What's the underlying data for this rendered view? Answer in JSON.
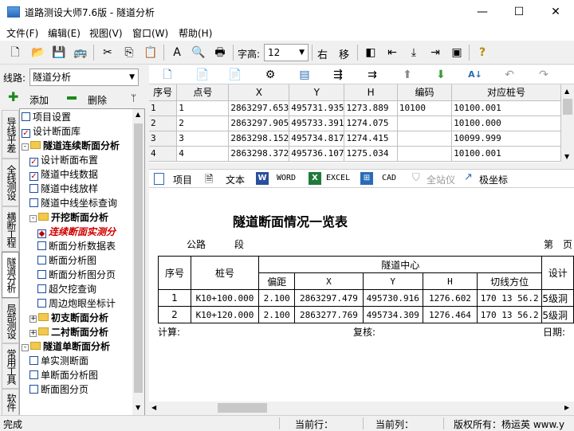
{
  "window": {
    "title": "道路测设大师7.6版 - 隧道分析",
    "controls": [
      "—",
      "☐",
      "✕"
    ]
  },
  "menu": [
    "文件(F)",
    "编辑(E)",
    "视图(V)",
    "窗口(W)",
    "帮助(H)"
  ],
  "toolbar": {
    "font_size_label": "字高:",
    "font_size_value": "12",
    "right_label": "右",
    "move_label": "移"
  },
  "left": {
    "route_label": "线路:",
    "route_value": "隧道分析",
    "add_label": "添加",
    "delete_label": "删除",
    "vertical_tabs": [
      "导线平差",
      "全线测设",
      "横断工程",
      "隧道分析",
      "局部测设",
      "常用工具",
      "软件"
    ],
    "active_tab": "隧道分析",
    "tree": [
      {
        "label": "项目设置",
        "kind": "check",
        "checked": false,
        "indent": 0
      },
      {
        "label": "设计断面库",
        "kind": "check",
        "checked": true,
        "indent": 0
      },
      {
        "label": "隧道连续断面分析",
        "kind": "folder",
        "expander": "-",
        "bold": true,
        "indent": 0
      },
      {
        "label": "设计断面布置",
        "kind": "check",
        "checked": true,
        "indent": 1
      },
      {
        "label": "隧道中线数据",
        "kind": "check",
        "checked": true,
        "indent": 1
      },
      {
        "label": "隧道中线放样",
        "kind": "check",
        "checked": false,
        "indent": 1
      },
      {
        "label": "隧道中线坐标查询",
        "kind": "check",
        "checked": false,
        "indent": 1
      },
      {
        "label": "开挖断面分析",
        "kind": "folder",
        "expander": "-",
        "bold": true,
        "indent": 1
      },
      {
        "label": "连续断面实测分",
        "kind": "check",
        "checked": true,
        "indent": 2,
        "highlight": true
      },
      {
        "label": "断面分析数据表",
        "kind": "check",
        "checked": false,
        "indent": 2
      },
      {
        "label": "断面分析图",
        "kind": "check",
        "checked": false,
        "indent": 2
      },
      {
        "label": "断面分析图分页",
        "kind": "check",
        "checked": false,
        "indent": 2
      },
      {
        "label": "超欠挖查询",
        "kind": "check",
        "checked": false,
        "indent": 2
      },
      {
        "label": "周边炮眼坐标计",
        "kind": "check",
        "checked": false,
        "indent": 2
      },
      {
        "label": "初支断面分析",
        "kind": "folder",
        "expander": "+",
        "bold": true,
        "indent": 1
      },
      {
        "label": "二衬断面分析",
        "kind": "folder",
        "expander": "+",
        "bold": true,
        "indent": 1
      },
      {
        "label": "隧道单断面分析",
        "kind": "folder",
        "expander": "-",
        "bold": true,
        "indent": 0
      },
      {
        "label": "单实测断面",
        "kind": "check",
        "checked": false,
        "indent": 1
      },
      {
        "label": "单断面分析图",
        "kind": "check",
        "checked": false,
        "indent": 1
      },
      {
        "label": "断面图分页",
        "kind": "check",
        "checked": false,
        "indent": 1
      }
    ]
  },
  "grid": {
    "columns": [
      "序号",
      "点号",
      "X",
      "Y",
      "H",
      "编码",
      "对应桩号"
    ],
    "rows": [
      [
        "1",
        "1",
        "2863297.653",
        "495731.935",
        "1273.889",
        "10100",
        "10100.001"
      ],
      [
        "2",
        "2",
        "2863297.905",
        "495733.391",
        "1274.075",
        "",
        "10100.000"
      ],
      [
        "3",
        "3",
        "2863298.152",
        "495734.817",
        "1274.415",
        "",
        "10099.999"
      ],
      [
        "4",
        "4",
        "2863298.372",
        "495736.107",
        "1275.034",
        "",
        "10100.001"
      ]
    ]
  },
  "report_toolbar": {
    "project": "项目",
    "text": "文本",
    "word": "WORD",
    "excel": "EXCEL",
    "cad": "CAD",
    "total_station": "全站仪",
    "polar": "极坐标"
  },
  "report": {
    "title": "隧道断面情况一览表",
    "road_label": "公路",
    "section_label": "段",
    "page_label": "第　页",
    "headers": {
      "seq": "序号",
      "station": "桩号",
      "tunnel_center": "隧道中心",
      "offset": "偏距",
      "x": "X",
      "y": "Y",
      "h": "H",
      "tangent": "切线方位",
      "design": "设计"
    },
    "rows": [
      [
        "1",
        "K10+100.000",
        "2.100",
        "2863297.479",
        "495730.916",
        "1276.602",
        "170 13 56.2",
        "5级洞"
      ],
      [
        "2",
        "K10+120.000",
        "2.100",
        "2863277.769",
        "495734.309",
        "1276.464",
        "170 13 56.2",
        "5级洞"
      ]
    ],
    "calc_label": "计算:",
    "review_label": "复核:",
    "date_label": "日期:"
  },
  "status": {
    "ready": "完成",
    "current_row": "当前行：",
    "current_col": "当前列：",
    "copyright": "版权所有：杨运英  www.y"
  }
}
